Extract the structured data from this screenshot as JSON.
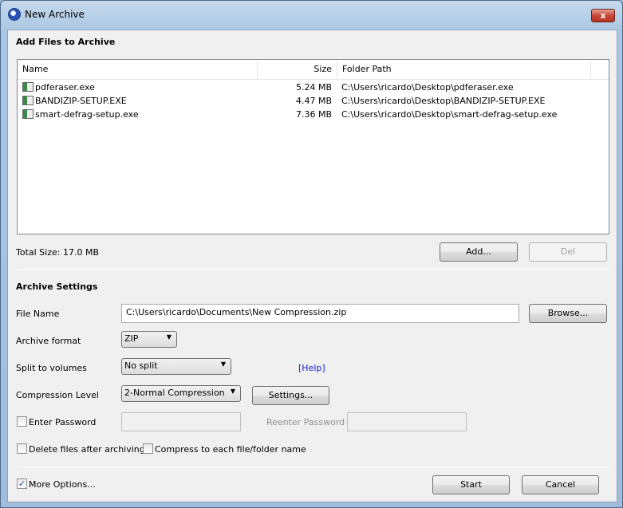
{
  "window": {
    "title": "New Archive",
    "close": "x"
  },
  "files_section": {
    "title": "Add Files to Archive",
    "columns": {
      "name": "Name",
      "size": "Size",
      "path": "Folder Path"
    },
    "rows": [
      {
        "name": "pdferaser.exe",
        "size": "5.24 MB",
        "path": "C:\\Users\\ricardo\\Desktop\\pdferaser.exe"
      },
      {
        "name": "BANDIZIP-SETUP.EXE",
        "size": "4.47 MB",
        "path": "C:\\Users\\ricardo\\Desktop\\BANDIZIP-SETUP.EXE"
      },
      {
        "name": "smart-defrag-setup.exe",
        "size": "7.36 MB",
        "path": "C:\\Users\\ricardo\\Desktop\\smart-defrag-setup.exe"
      }
    ],
    "total": "Total Size: 17.0 MB",
    "add": "Add...",
    "del": "Del"
  },
  "settings": {
    "title": "Archive Settings",
    "file_name_label": "File Name",
    "file_name": "C:\\Users\\ricardo\\Documents\\New Compression.zip",
    "browse": "Browse...",
    "format_label": "Archive format",
    "format": "ZIP",
    "split_label": "Split to volumes",
    "split": "No split",
    "help": "[Help]",
    "level_label": "Compression Level",
    "level": "2-Normal Compression",
    "level_settings": "Settings...",
    "password_label": "Enter Password",
    "reenter_label": "Reenter Password",
    "delete_label": "Delete files after archiving",
    "each_label": "Compress to each file/folder name",
    "more_label": "More Options...",
    "more_checked": true,
    "start": "Start",
    "cancel": "Cancel"
  }
}
